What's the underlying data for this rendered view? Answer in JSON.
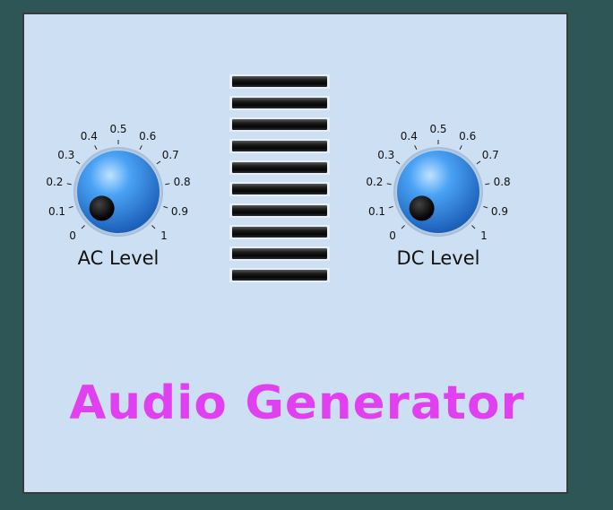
{
  "knobs": [
    {
      "id": "ac",
      "label": "AC Level",
      "value": 0,
      "scale": [
        "0",
        "0.1",
        "0.2",
        "0.3",
        "0.4",
        "0.5",
        "0.6",
        "0.7",
        "0.8",
        "0.9",
        "1"
      ]
    },
    {
      "id": "dc",
      "label": "DC Level",
      "value": 0,
      "scale": [
        "0",
        "0.1",
        "0.2",
        "0.3",
        "0.4",
        "0.5",
        "0.6",
        "0.7",
        "0.8",
        "0.9",
        "1"
      ]
    }
  ],
  "meter": {
    "segments": 10,
    "lit_segments": 0
  },
  "title": "Audio Generator",
  "colors": {
    "background": "#2f5656",
    "panel": "#cddff3",
    "knob": "#3f96ec",
    "title": "#e040f0",
    "meter_off": "#0a0a0a"
  }
}
